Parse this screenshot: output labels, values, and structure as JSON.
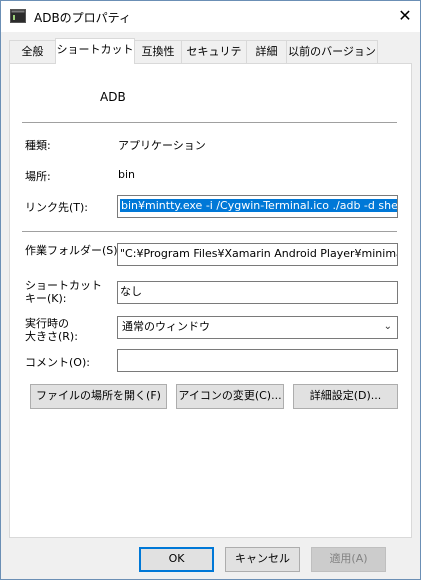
{
  "window": {
    "title": "ADBのプロパティ",
    "close_glyph": "✕"
  },
  "tabs": [
    {
      "label": "全般"
    },
    {
      "label": "ショートカット"
    },
    {
      "label": "互換性"
    },
    {
      "label": "セキュリティ"
    },
    {
      "label": "詳細"
    },
    {
      "label": "以前のバージョン"
    }
  ],
  "shortcut": {
    "name": "ADB",
    "type_label": "種類:",
    "type_value": "アプリケーション",
    "location_label": "場所:",
    "location_value": "bin",
    "target_label": "リンク先(T):",
    "target_value": "bin¥mintty.exe -i /Cygwin-Terminal.ico ./adb -d shell",
    "startin_label": "作業フォルダー(S):",
    "startin_value": "\"C:¥Program Files¥Xamarin Android Player¥minimal_",
    "hotkey_label_1": "ショートカット",
    "hotkey_label_2": "キー(K):",
    "hotkey_value": "なし",
    "run_label_1": "実行時の",
    "run_label_2": "大きさ(R):",
    "run_value": "通常のウィンドウ",
    "comment_label": "コメント(O):",
    "comment_value": ""
  },
  "buttons": {
    "open_location": "ファイルの場所を開く(F)",
    "change_icon": "アイコンの変更(C)...",
    "advanced": "詳細設定(D)...",
    "ok": "OK",
    "cancel": "キャンセル",
    "apply": "適用(A)"
  },
  "colors": {
    "selection": "#0078d7",
    "default_button_border": "#0078d7"
  }
}
